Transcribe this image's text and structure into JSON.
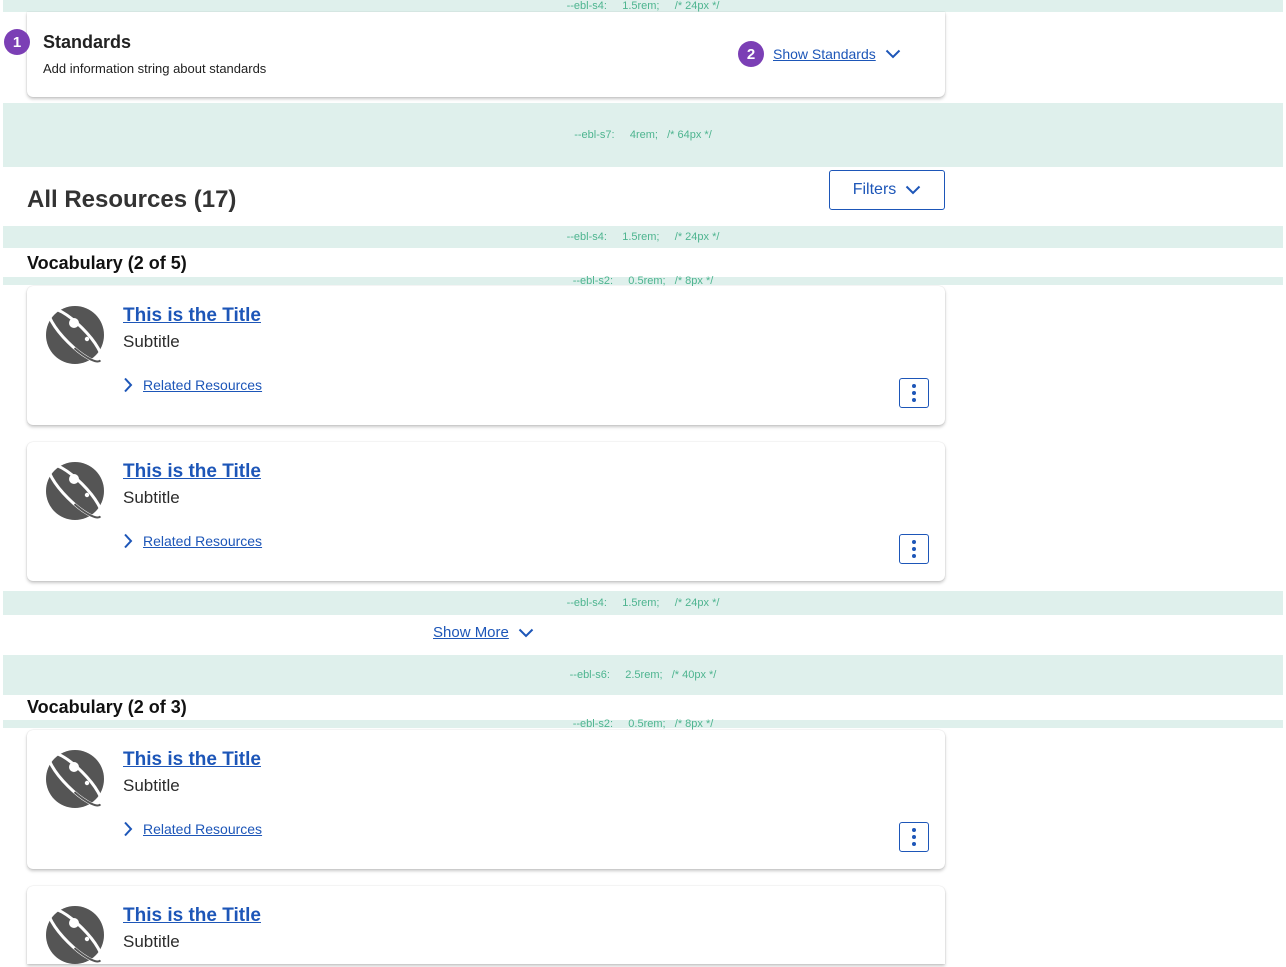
{
  "spacers": {
    "s4_top": "--ebl-s4:     1.5rem;     /* 24px */",
    "s7": "--ebl-s7:     4rem;   /* 64px */",
    "s4_a": "--ebl-s4:     1.5rem;     /* 24px */",
    "s2_a": "--ebl-s2:     0.5rem;   /* 8px */",
    "s4_b": "--ebl-s4:     1.5rem;     /* 24px */",
    "s6": "--ebl-s6:     2.5rem;   /* 40px */",
    "s2_b": "--ebl-s2:     0.5rem;   /* 8px */"
  },
  "standards": {
    "marker": "1",
    "title": "Standards",
    "description": "Add information string about standards",
    "toggle_marker": "2",
    "toggle_label": "Show Standards"
  },
  "resources_header": {
    "title": "All Resources (17)",
    "filters_label": "Filters"
  },
  "sections": [
    {
      "title": "Vocabulary (2 of 5)",
      "items": [
        {
          "title": "This is the Title",
          "subtitle": "Subtitle",
          "related": "Related Resources"
        },
        {
          "title": "This is the Title",
          "subtitle": "Subtitle",
          "related": "Related Resources"
        }
      ],
      "show_more": "Show More"
    },
    {
      "title": "Vocabulary (2 of 3)",
      "items": [
        {
          "title": "This is the Title",
          "subtitle": "Subtitle",
          "related": "Related Resources"
        },
        {
          "title": "This is the Title",
          "subtitle": "Subtitle"
        }
      ]
    }
  ],
  "colors": {
    "accent": "#1d56b8",
    "marker": "#7b3fb5",
    "spacer_bg": "#dff0ec",
    "spacer_text": "#4db48f"
  },
  "icons": {
    "resource_thumbnail": "science-atom-icon",
    "expand": "chevron-down-icon",
    "related": "chevron-right-icon",
    "menu": "kebab-menu-icon"
  }
}
